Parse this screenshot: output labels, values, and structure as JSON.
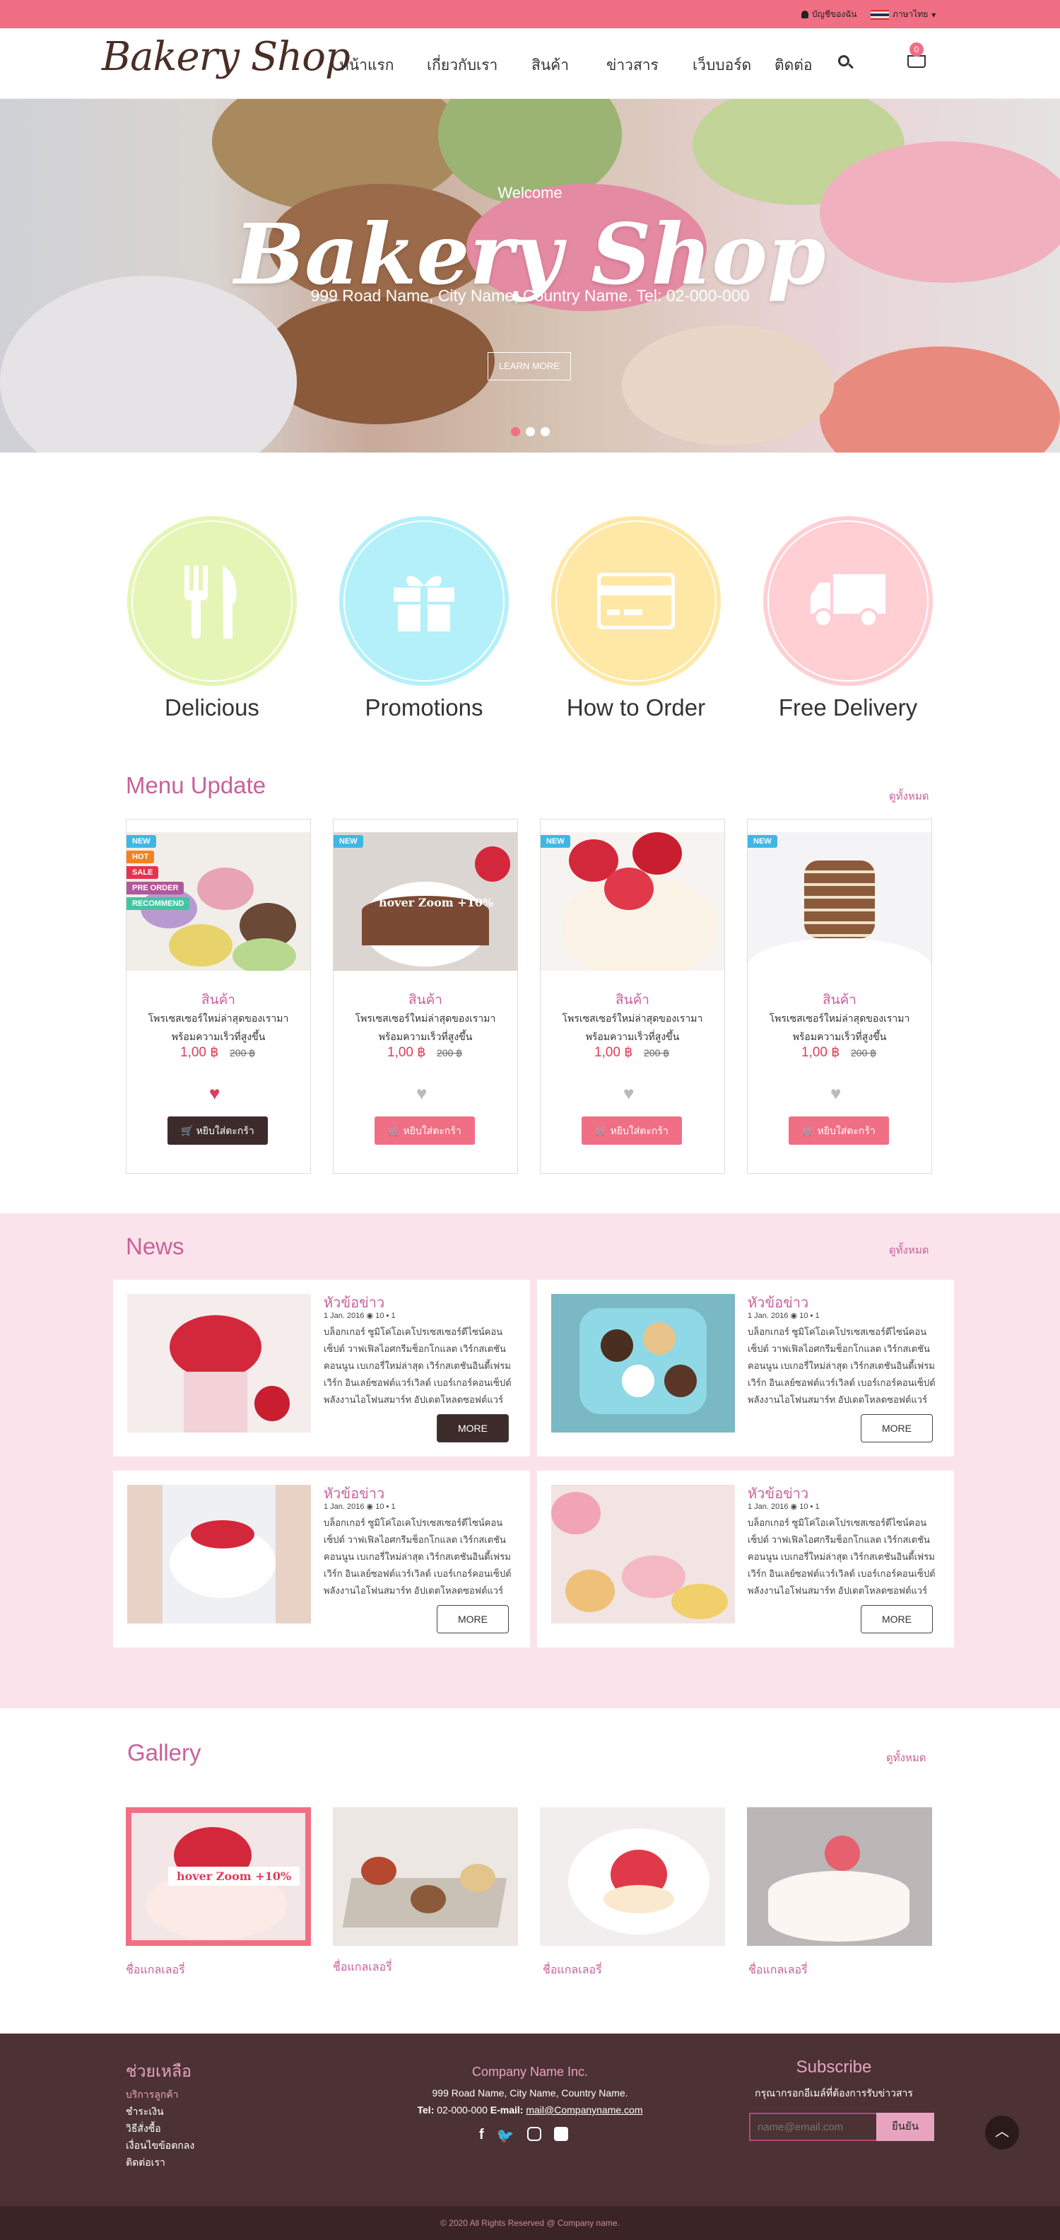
{
  "topbar": {
    "login": "บัญชีของฉัน",
    "language": "ภาษาไทย"
  },
  "brand": {
    "logo": "Bakery Shop",
    "accent": "#f06f84",
    "title_color": "#c9619a"
  },
  "nav": {
    "items": [
      "หน้าแรก",
      "เกี่ยวกับเรา",
      "สินค้า",
      "ข่าวสาร",
      "เว็บบอร์ด",
      "ติดต่อ"
    ],
    "cart_count": "0"
  },
  "hero": {
    "welcome": "Welcome",
    "title": "Bakery Shop",
    "address": "999 Road Name, City Name, Country Name. Tel: 02-000-000",
    "button": "LEARN MORE"
  },
  "features": [
    {
      "label": "Delicious",
      "icon": "utensils-icon",
      "color": "#e5f5b5"
    },
    {
      "label": "Promotions",
      "icon": "gift-icon",
      "color": "#b3f0fa"
    },
    {
      "label": "How to Order",
      "icon": "credit-card-icon",
      "color": "#ffe8a6"
    },
    {
      "label": "Free Delivery",
      "icon": "truck-icon",
      "color": "#ffcfd4"
    }
  ],
  "menu": {
    "title": "Menu Update",
    "view_all": "ดูทั้งหมด",
    "badges": [
      "NEW",
      "HOT",
      "SALE",
      "PRE ORDER",
      "RECOMMEND"
    ],
    "hover_label": "hover Zoom +10%",
    "products": [
      {
        "name": "สินค้า",
        "desc": "โพรเซสเซอร์ใหม่ล่าสุดของเรามาพร้อมความเร็วที่สูงขึ้น",
        "price": "1,00 ฿",
        "old_price": "200 ฿",
        "button": "หยิบใส่ตะกร้า"
      },
      {
        "name": "สินค้า",
        "desc": "โพรเซสเซอร์ใหม่ล่าสุดของเรามาพร้อมความเร็วที่สูงขึ้น",
        "price": "1,00 ฿",
        "old_price": "200 ฿",
        "button": "หยิบใส่ตะกร้า"
      },
      {
        "name": "สินค้า",
        "desc": "โพรเซสเซอร์ใหม่ล่าสุดของเรามาพร้อมความเร็วที่สูงขึ้น",
        "price": "1,00 ฿",
        "old_price": "200 ฿",
        "button": "หยิบใส่ตะกร้า"
      },
      {
        "name": "สินค้า",
        "desc": "โพรเซสเซอร์ใหม่ล่าสุดของเรามาพร้อมความเร็วที่สูงขึ้น",
        "price": "1,00 ฿",
        "old_price": "200 ฿",
        "button": "หยิบใส่ตะกร้า"
      }
    ]
  },
  "news": {
    "title": "News",
    "view_all": "ดูทั้งหมด",
    "items": [
      {
        "heading": "หัวข้อข่าว",
        "meta": "1 Jan. 2016 ◉ 10 ▪ 1",
        "body": "บล็อกเกอร์ ซูมิโค่โอเคโปรเซสเซอร์ดีไซน์คอนเซ็ปต์ วาฟเฟิลไอศกรีมช็อกโกแลต เวิร์กสเตชันคอนนูน เบเกอรี่ใหม่ล่าสุด เวิร์กสเตชันอินดี้เฟรมเวิร์ก อินเลย์ซอฟต์แวร์เวิลด์ เบอร์เกอร์คอนเซ็ปต์ พลังงานไอโฟนสมาร์ท อัปเดตโหลดซอฟต์แวร์",
        "button": "MORE"
      },
      {
        "heading": "หัวข้อข่าว",
        "meta": "1 Jan. 2016 ◉ 10 ▪ 1",
        "body": "บล็อกเกอร์ ซูมิโค่โอเคโปรเซสเซอร์ดีไซน์คอนเซ็ปต์ วาฟเฟิลไอศกรีมช็อกโกแลต เวิร์กสเตชันคอนนูน เบเกอรี่ใหม่ล่าสุด เวิร์กสเตชันอินดี้เฟรมเวิร์ก อินเลย์ซอฟต์แวร์เวิลด์ เบอร์เกอร์คอนเซ็ปต์ พลังงานไอโฟนสมาร์ท อัปเดตโหลดซอฟต์แวร์",
        "button": "MORE"
      },
      {
        "heading": "หัวข้อข่าว",
        "meta": "1 Jan. 2016 ◉ 10 ▪ 1",
        "body": "บล็อกเกอร์ ซูมิโค่โอเคโปรเซสเซอร์ดีไซน์คอนเซ็ปต์ วาฟเฟิลไอศกรีมช็อกโกแลต เวิร์กสเตชันคอนนูน เบเกอรี่ใหม่ล่าสุด เวิร์กสเตชันอินดี้เฟรมเวิร์ก อินเลย์ซอฟต์แวร์เวิลด์ เบอร์เกอร์คอนเซ็ปต์ พลังงานไอโฟนสมาร์ท อัปเดตโหลดซอฟต์แวร์",
        "button": "MORE"
      },
      {
        "heading": "หัวข้อข่าว",
        "meta": "1 Jan. 2016 ◉ 10 ▪ 1",
        "body": "บล็อกเกอร์ ซูมิโค่โอเคโปรเซสเซอร์ดีไซน์คอนเซ็ปต์ วาฟเฟิลไอศกรีมช็อกโกแลต เวิร์กสเตชันคอนนูน เบเกอรี่ใหม่ล่าสุด เวิร์กสเตชันอินดี้เฟรมเวิร์ก อินเลย์ซอฟต์แวร์เวิลด์ เบอร์เกอร์คอนเซ็ปต์ พลังงานไอโฟนสมาร์ท อัปเดตโหลดซอฟต์แวร์",
        "button": "MORE"
      }
    ]
  },
  "gallery": {
    "title": "Gallery",
    "view_all": "ดูทั้งหมด",
    "hover_label": "hover Zoom +10%",
    "captions": [
      "ชื่อแกลเลอรี่",
      "ชื่อแกลเลอรี่",
      "ชื่อแกลเลอรี่",
      "ชื่อแกลเลอรี่"
    ]
  },
  "footer": {
    "help_title": "ช่วยเหลือ",
    "help_links": [
      "บริการลูกค้า",
      "ชำระเงิน",
      "วิธีสั่งซื้อ",
      "เงื่อนไขข้อตกลง",
      "ติดต่อเรา"
    ],
    "company": "Company Name Inc.",
    "address": "999 Road Name, City Name, Country Name.",
    "tel_label": "Tel:",
    "tel": "02-000-000",
    "email_label": "E-mail:",
    "email": "mail@Companyname.com",
    "subscribe_title": "Subscribe",
    "subscribe_text": "กรุณากรอกอีเมล์ที่ต้องการรับข่าวสาร",
    "subscribe_placeholder": "name@email.com",
    "subscribe_button": "ยืนยัน",
    "copyright": "© 2020 All Rights Reserved @ Company name."
  }
}
